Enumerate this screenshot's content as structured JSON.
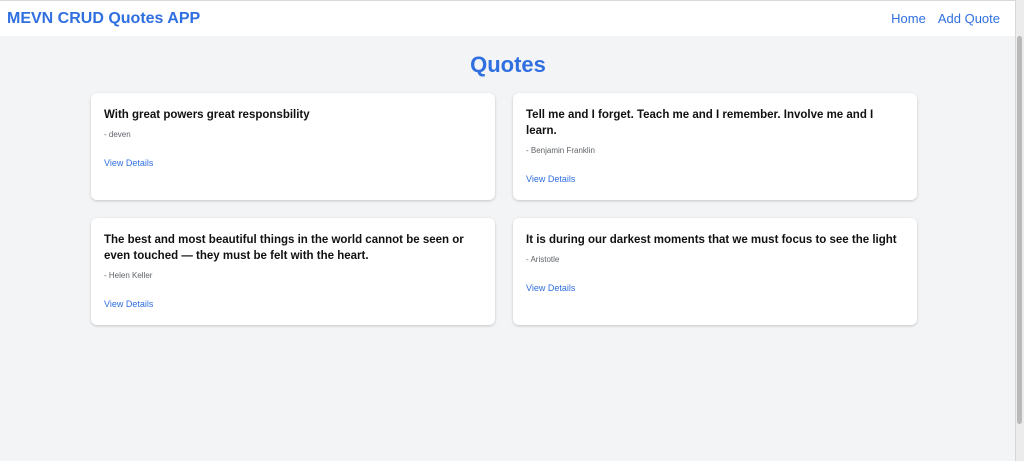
{
  "navbar": {
    "brand": "MEVN CRUD Quotes APP",
    "links": [
      {
        "label": "Home"
      },
      {
        "label": "Add Quote"
      }
    ]
  },
  "main": {
    "title": "Quotes",
    "cards": [
      {
        "quote": "With great powers great responsbility",
        "author": "- deven",
        "action": "View Details"
      },
      {
        "quote": "Tell me and I forget. Teach me and I remember. Involve me and I learn.",
        "author": "- Benjamin Franklin",
        "action": "View Details"
      },
      {
        "quote": "The best and most beautiful things in the world cannot be seen or even touched — they must be felt with the heart.",
        "author": "- Helen Keller",
        "action": "View Details"
      },
      {
        "quote": "It is during our darkest moments that we must focus to see the light",
        "author": "- Aristotle",
        "action": "View Details"
      }
    ]
  },
  "colors": {
    "accent": "#2f6fe0",
    "background": "#f3f4f6",
    "card": "#ffffff",
    "text": "#111111",
    "muted": "#5f6368"
  }
}
